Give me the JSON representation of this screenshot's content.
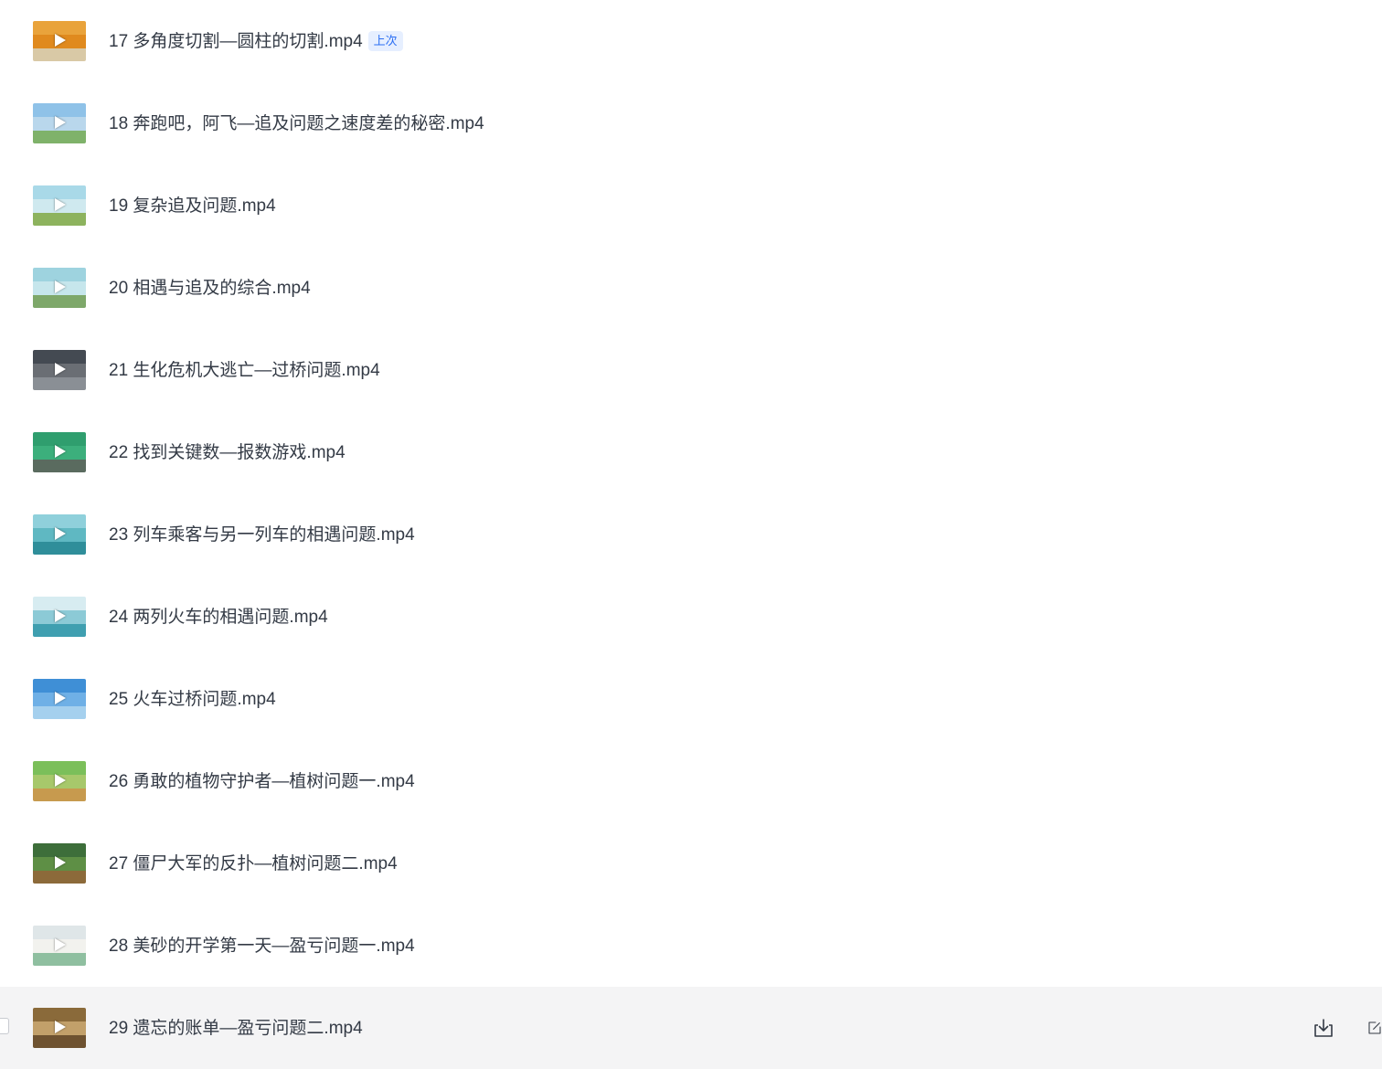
{
  "files": [
    {
      "name": "17 多角度切割—圆柱的切割.mp4",
      "badge": "上次",
      "thumbnail": {
        "top": "#e9a33b",
        "mid": "#e08a1e",
        "bottom": "#d9c9a6",
        "icon": "video-thumbnail-icon"
      }
    },
    {
      "name": "18 奔跑吧，阿飞—追及问题之速度差的秘密.mp4",
      "thumbnail": {
        "top": "#8fc2e8",
        "mid": "#b9d7ec",
        "bottom": "#7fb26a",
        "icon": "video-thumbnail-icon"
      }
    },
    {
      "name": "19 复杂追及问题.mp4",
      "thumbnail": {
        "top": "#a9d9e8",
        "mid": "#cfe9ef",
        "bottom": "#8db35e",
        "icon": "video-thumbnail-icon"
      }
    },
    {
      "name": "20 相遇与追及的综合.mp4",
      "thumbnail": {
        "top": "#9ed3df",
        "mid": "#c6e6ec",
        "bottom": "#7ea86a",
        "icon": "video-thumbnail-icon"
      }
    },
    {
      "name": "21 生化危机大逃亡—过桥问题.mp4",
      "thumbnail": {
        "top": "#444a52",
        "mid": "#6a6e74",
        "bottom": "#8a8f95",
        "icon": "video-thumbnail-icon"
      }
    },
    {
      "name": "22 找到关键数—报数游戏.mp4",
      "thumbnail": {
        "top": "#2f9e6e",
        "mid": "#3caf7c",
        "bottom": "#5a6b5f",
        "icon": "video-thumbnail-icon"
      }
    },
    {
      "name": "23 列车乘客与另一列车的相遇问题.mp4",
      "thumbnail": {
        "top": "#8fd0db",
        "mid": "#5fb8c2",
        "bottom": "#2f8e9a",
        "icon": "video-thumbnail-icon"
      }
    },
    {
      "name": "24 两列火车的相遇问题.mp4",
      "thumbnail": {
        "top": "#d7ecf1",
        "mid": "#8ccad6",
        "bottom": "#3f9fb0",
        "icon": "video-thumbnail-icon"
      }
    },
    {
      "name": "25 火车过桥问题.mp4",
      "thumbnail": {
        "top": "#3f8fd6",
        "mid": "#6fb0e6",
        "bottom": "#a5d0ee",
        "icon": "video-thumbnail-icon"
      }
    },
    {
      "name": "26 勇敢的植物守护者—植树问题一.mp4",
      "thumbnail": {
        "top": "#7bbf5a",
        "mid": "#a7c86b",
        "bottom": "#c79a4e",
        "icon": "video-thumbnail-icon"
      }
    },
    {
      "name": "27 僵尸大军的反扑—植树问题二.mp4",
      "thumbnail": {
        "top": "#3d6e3a",
        "mid": "#5e8f45",
        "bottom": "#8c6a3a",
        "icon": "video-thumbnail-icon"
      }
    },
    {
      "name": "28 美砂的开学第一天—盈亏问题一.mp4",
      "thumbnail": {
        "top": "#dfe6e8",
        "mid": "#f2f2ee",
        "bottom": "#8fbfa0",
        "icon": "video-thumbnail-icon"
      }
    },
    {
      "name": "29 遗忘的账单—盈亏问题二.mp4",
      "thumbnail": {
        "top": "#8a6a3a",
        "mid": "#c2a06a",
        "bottom": "#6e5230",
        "icon": "video-thumbnail-icon"
      },
      "hovered": true,
      "actions": [
        "download-icon",
        "share-icon"
      ]
    }
  ]
}
